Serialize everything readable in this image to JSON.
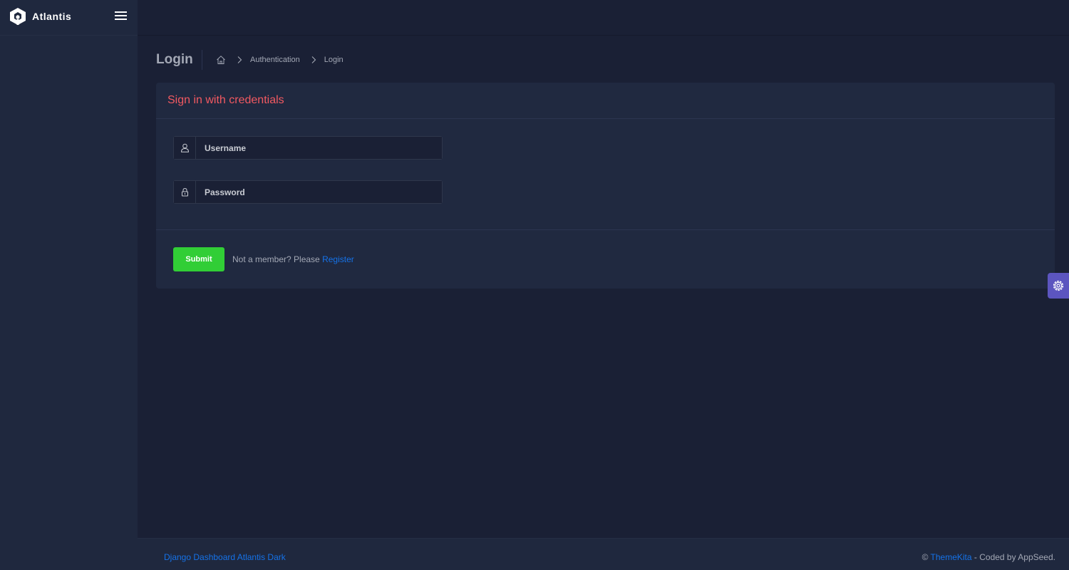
{
  "app": {
    "brand": "Atlantis"
  },
  "page": {
    "title": "Login",
    "breadcrumbs": [
      "Authentication",
      "Login"
    ]
  },
  "login_card": {
    "title": "Sign in with credentials",
    "username_placeholder": "Username",
    "username_value": "",
    "password_placeholder": "Password",
    "password_value": "",
    "submit_label": "Submit",
    "register_prompt": "Not a member? Please",
    "register_link": "Register"
  },
  "footer": {
    "left_link": "Django Dashboard Atlantis Dark",
    "copyright_symbol": "©",
    "right_link": "ThemeKita",
    "right_suffix": "- Coded by AppSeed."
  },
  "icons": {
    "logo": "atlantis-logo-icon",
    "menu_toggle": "hamburger-icon",
    "home": "home-icon",
    "chevron": "chevron-right-icon",
    "user": "user-icon",
    "lock": "lock-icon",
    "settings": "gear-icon"
  },
  "colors": {
    "background": "#1a2035",
    "panel": "#202940",
    "sidebar": "#1f283e",
    "accent_red": "#f25961",
    "success": "#31ce36",
    "link": "#1572e8",
    "settings_toggle": "#5c55bf"
  }
}
